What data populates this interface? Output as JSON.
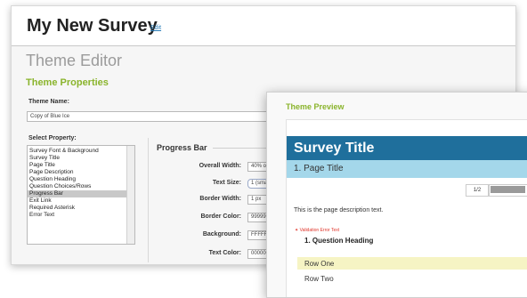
{
  "header": {
    "survey_name": "My New Survey",
    "edit_link": "Edit"
  },
  "editor": {
    "title": "Theme Editor",
    "section_title": "Theme Properties",
    "theme_name_label": "Theme Name:",
    "theme_name_value": "Copy of Blue Ice",
    "select_property_label": "Select Property:",
    "properties": [
      {
        "label": "Survey Font & Background",
        "selected": false
      },
      {
        "label": "Survey Title",
        "selected": false
      },
      {
        "label": "Page Title",
        "selected": false
      },
      {
        "label": "Page Description",
        "selected": false
      },
      {
        "label": "Question Heading",
        "selected": false
      },
      {
        "label": "Question Choices/Rows",
        "selected": false
      },
      {
        "label": "Progress Bar",
        "selected": true
      },
      {
        "label": "Exit Link",
        "selected": false
      },
      {
        "label": "Required Asterisk",
        "selected": false
      },
      {
        "label": "Error Text",
        "selected": false
      }
    ],
    "progress_bar": {
      "title": "Progress Bar",
      "overall_width_label": "Overall Width:",
      "overall_width_value": "40% of pa",
      "text_size_label": "Text Size:",
      "text_size_value": "1 (smalles",
      "border_width_label": "Border Width:",
      "border_width_value": "1 px",
      "border_color_label": "Border Color:",
      "border_color_value": "999999",
      "background_label": "Background:",
      "background_value": "FFFFFF",
      "text_color_label": "Text Color:",
      "text_color_value": "000000"
    }
  },
  "preview": {
    "title": "Theme Preview",
    "survey_title": "Survey Title",
    "page_title": "1. Page Title",
    "progress_label": "1/2",
    "progress_fraction": 0.5,
    "page_description": "This is the page description text.",
    "validation_error": "Validation Error Text",
    "question_heading": "1. Question Heading",
    "rows": [
      "Row One",
      "Row Two"
    ]
  },
  "colors": {
    "accent_green": "#8ab42c",
    "survey_title_bar": "#1f6f9c",
    "page_title_bar": "#a4d7ea",
    "error_red": "#e0352b"
  }
}
